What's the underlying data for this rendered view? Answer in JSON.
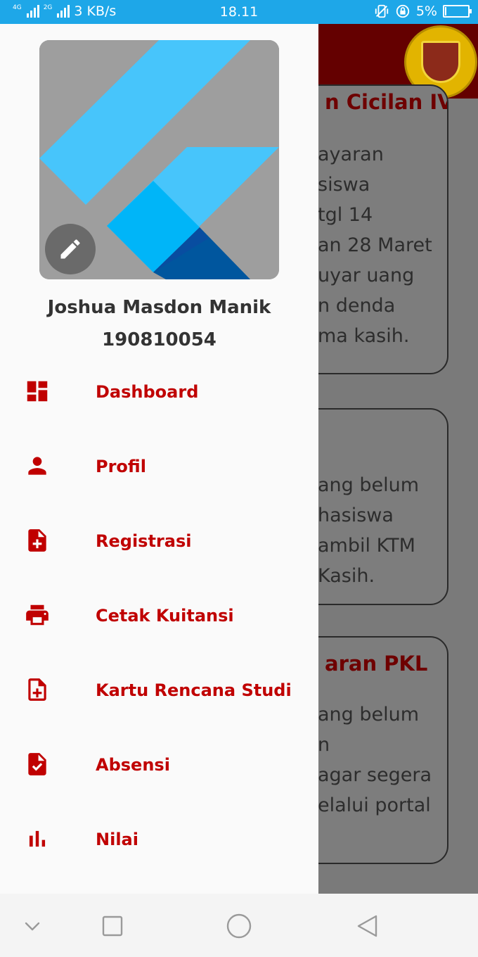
{
  "status_bar": {
    "network_1": "4G",
    "network_2": "2G",
    "speed": "3 KB/s",
    "time": "18.11",
    "battery_percent": "5%",
    "battery_level": 0.05,
    "background_color": "#1ea7e8"
  },
  "drawer": {
    "user": {
      "name": "Joshua Masdon Manik",
      "id": "190810054",
      "edit_icon": "pencil-icon"
    },
    "menu": [
      {
        "label": "Dashboard",
        "icon": "dashboard-icon"
      },
      {
        "label": "Profil",
        "icon": "person-icon"
      },
      {
        "label": "Registrasi",
        "icon": "note-add-icon"
      },
      {
        "label": "Cetak Kuitansi",
        "icon": "printer-icon"
      },
      {
        "label": "Kartu Rencana Studi",
        "icon": "note-add-outline-icon"
      },
      {
        "label": "Absensi",
        "icon": "file-check-icon"
      },
      {
        "label": "Nilai",
        "icon": "bar-chart-icon"
      }
    ],
    "accent_color": "#c00000"
  },
  "background": {
    "app_bar_color": "#640000",
    "cards": [
      {
        "title": "n Cicilan IV",
        "lines": [
          "ayaran",
          "siswa",
          "tgl 14",
          "an 28 Maret",
          "uyar uang",
          "n denda",
          "ma kasih."
        ]
      },
      {
        "title": "",
        "lines": [
          "ang belum",
          "hasiswa",
          "ambil KTM",
          "Kasih."
        ]
      },
      {
        "title": "aran PKL",
        "lines": [
          "ang belum",
          "n",
          "agar segera",
          "elalui portal"
        ]
      }
    ]
  },
  "nav_bar": {
    "icons": [
      "chevron-down-icon",
      "recents-icon",
      "home-icon",
      "back-icon"
    ]
  }
}
